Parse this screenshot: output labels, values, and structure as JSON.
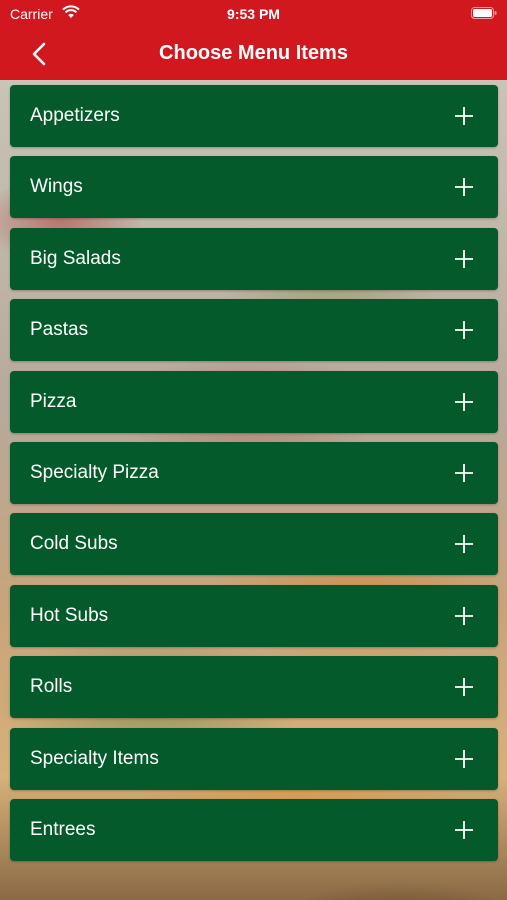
{
  "status_bar": {
    "carrier": "Carrier",
    "time": "9:53 PM"
  },
  "nav": {
    "title": "Choose Menu Items",
    "back_icon": "chevron-left-icon"
  },
  "menu": {
    "items": [
      {
        "label": "Appetizers"
      },
      {
        "label": "Wings"
      },
      {
        "label": "Big Salads"
      },
      {
        "label": "Pastas"
      },
      {
        "label": "Pizza"
      },
      {
        "label": "Specialty Pizza"
      },
      {
        "label": "Cold Subs"
      },
      {
        "label": "Hot Subs"
      },
      {
        "label": "Rolls"
      },
      {
        "label": "Specialty Items"
      },
      {
        "label": "Entrees"
      }
    ],
    "expand_icon": "plus-icon"
  },
  "colors": {
    "header": "#d1181f",
    "row": "#045a2b",
    "text": "#ffffff"
  }
}
